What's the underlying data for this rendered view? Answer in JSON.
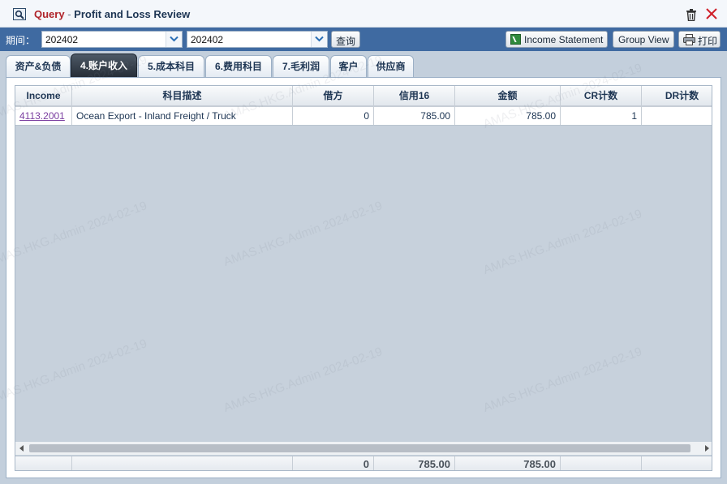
{
  "window": {
    "title_query": "Query",
    "title_separator": "-",
    "title_rest": "Profit and Loss Review"
  },
  "toolbar": {
    "period_label": "期间：",
    "period_from": "202402",
    "period_to": "202402",
    "query_button": "查询",
    "income_statement_button": "Income Statement",
    "group_view_button": "Group View",
    "print_button": "打印"
  },
  "tabs": [
    {
      "label": "资产&负债",
      "active": false
    },
    {
      "label": "4.账户收入",
      "active": true
    },
    {
      "label": "5.成本科目",
      "active": false
    },
    {
      "label": "6.费用科目",
      "active": false
    },
    {
      "label": "7.毛利润",
      "active": false
    },
    {
      "label": "客户",
      "active": false
    },
    {
      "label": "供应商",
      "active": false
    }
  ],
  "grid": {
    "columns": [
      "Income",
      "科目描述",
      "借方",
      "信用16",
      "金额",
      "CR计数",
      "DR计数"
    ],
    "rows": [
      {
        "income": "4113.2001",
        "description": "Ocean Export - Inland Freight / Truck",
        "debit": "0",
        "credit": "785.00",
        "amount": "785.00",
        "cr_count": "1",
        "dr_count": ""
      }
    ],
    "totals": {
      "debit": "0",
      "credit": "785.00",
      "amount": "785.00"
    }
  },
  "watermark": "AMAS.HKG.Admin 2024-02-19",
  "colors": {
    "toolbar_bg": "#3f6aa1",
    "title_query": "#b0242a",
    "active_tab": "#262e38",
    "link": "#7b3fa0",
    "grid_empty": "#c7d1dc"
  }
}
